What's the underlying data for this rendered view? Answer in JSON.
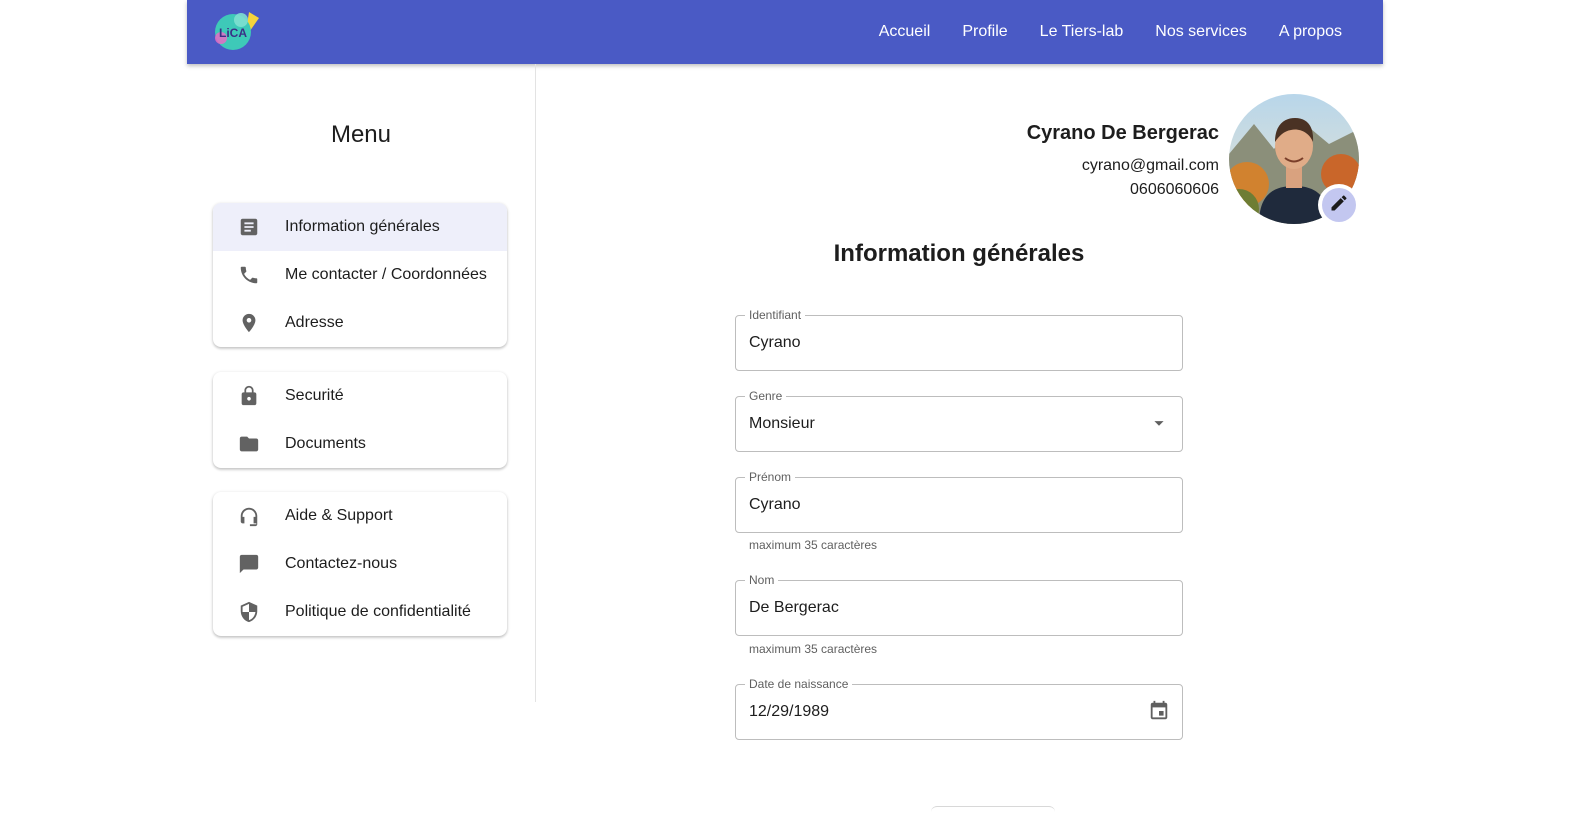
{
  "nav": {
    "logo_text": "LiCA",
    "links": [
      "Accueil",
      "Profile",
      "Le Tiers-lab",
      "Nos services",
      "A propos"
    ]
  },
  "sidebar": {
    "title": "Menu",
    "groups": [
      {
        "items": [
          {
            "label": "Information générales",
            "icon": "article-icon",
            "active": true
          },
          {
            "label": "Me contacter / Coordonnées",
            "icon": "phone-icon"
          },
          {
            "label": "Adresse",
            "icon": "location-pin-icon"
          }
        ]
      },
      {
        "items": [
          {
            "label": "Securité",
            "icon": "lock-icon"
          },
          {
            "label": "Documents",
            "icon": "folder-icon"
          }
        ]
      },
      {
        "items": [
          {
            "label": "Aide & Support",
            "icon": "headset-icon"
          },
          {
            "label": "Contactez-nous",
            "icon": "chat-icon"
          },
          {
            "label": "Politique de confidentialité",
            "icon": "shield-icon"
          }
        ]
      }
    ]
  },
  "profile": {
    "name": "Cyrano De Bergerac",
    "email": "cyrano@gmail.com",
    "phone": "0606060606"
  },
  "form": {
    "title": "Information générales",
    "identifiant": {
      "label": "Identifiant",
      "value": "Cyrano"
    },
    "genre": {
      "label": "Genre",
      "value": "Monsieur"
    },
    "prenom": {
      "label": "Prénom",
      "value": "Cyrano",
      "hint": "maximum 35 caractères"
    },
    "nom": {
      "label": "Nom",
      "value": "De Bergerac",
      "hint": "maximum 35 caractères"
    },
    "naissance": {
      "label": "Date de naissance",
      "value": "12/29/1989"
    }
  },
  "colors": {
    "primary": "#4a5ac5",
    "active_item_bg": "#eeeffa",
    "edit_button": "#c3c7f0"
  }
}
